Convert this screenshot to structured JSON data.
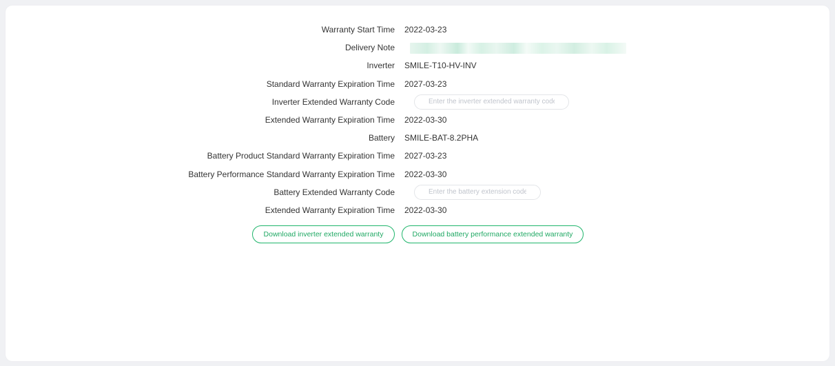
{
  "warranty": {
    "rows": [
      {
        "label": "Warranty Start Time",
        "value": "2022-03-23"
      },
      {
        "label": "Delivery Note",
        "value": ""
      },
      {
        "label": "Inverter",
        "value": "SMILE-T10-HV-INV"
      },
      {
        "label": "Standard Warranty Expiration Time",
        "value": "2027-03-23"
      },
      {
        "label": "Inverter Extended Warranty Code",
        "value": ""
      },
      {
        "label": "Extended Warranty Expiration Time",
        "value": "2022-03-30"
      },
      {
        "label": "Battery",
        "value": "SMILE-BAT-8.2PHA"
      },
      {
        "label": "Battery Product Standard Warranty Expiration Time",
        "value": "2027-03-23"
      },
      {
        "label": "Battery Performance Standard Warranty Expiration Time",
        "value": "2022-03-30"
      },
      {
        "label": "Battery Extended Warranty Code",
        "value": ""
      },
      {
        "label": "Extended Warranty Expiration Time",
        "value": "2022-03-30"
      }
    ],
    "inverter_code": {
      "value": "",
      "placeholder": "Enter the inverter extended warranty code"
    },
    "battery_code": {
      "value": "",
      "placeholder": "Enter the battery extension code"
    }
  },
  "actions": {
    "download_inverter_label": "Download inverter extended warranty",
    "download_battery_label": "Download battery performance extended warranty"
  },
  "colors": {
    "accent": "#1fb56b",
    "page_background": "#f0f1f4",
    "card_background": "#ffffff",
    "text": "#333333"
  }
}
